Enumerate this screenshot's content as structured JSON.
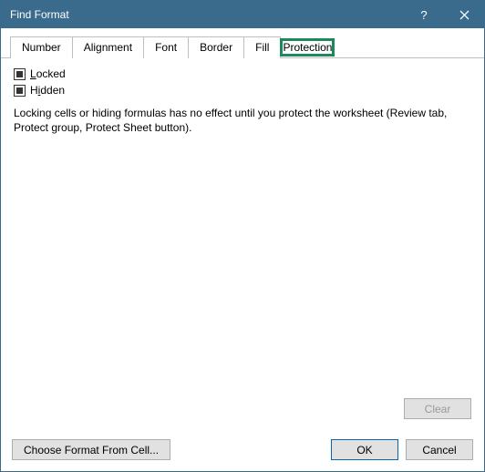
{
  "titlebar": {
    "title": "Find Format",
    "help": "?",
    "close": "×"
  },
  "tabs": [
    {
      "label": "Number"
    },
    {
      "label": "Alignment"
    },
    {
      "label": "Font"
    },
    {
      "label": "Border"
    },
    {
      "label": "Fill"
    },
    {
      "label": "Protection",
      "active": true
    }
  ],
  "protection": {
    "locked_prefix": "L",
    "locked_rest": "ocked",
    "hidden_prefix": "H",
    "hidden_underline": "i",
    "hidden_rest": "dden",
    "info": "Locking cells or hiding formulas has no effect until you protect the worksheet (Review tab, Protect group, Protect Sheet button).",
    "clear": "Clear"
  },
  "buttons": {
    "choose_format": "Choose Format From Cell...",
    "ok": "OK",
    "cancel": "Cancel"
  }
}
